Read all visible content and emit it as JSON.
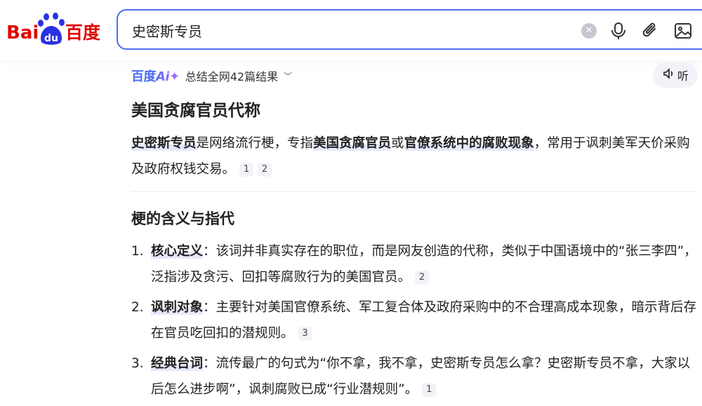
{
  "brand": {
    "logo_text_latin": "Bai",
    "logo_text_du": "du",
    "logo_text_cn": "百度",
    "colors": {
      "red": "#e10601",
      "blue": "#2932e1",
      "accent": "#4e6ef2"
    }
  },
  "search": {
    "query": "史密斯专员",
    "icons": [
      "clear-icon",
      "microphone-icon",
      "attachment-icon",
      "image-search-icon"
    ]
  },
  "ai_bar": {
    "logo": "百度",
    "logo_ai": "Ai",
    "summary": "总结全网42篇结果",
    "listen_label": "听"
  },
  "answer": {
    "title": "美国贪腐官员代称",
    "intro": {
      "part1": "史密斯专员",
      "part2": "是网络流行梗，专指",
      "part3": "美国贪腐官员",
      "part4": "或",
      "part5": "官僚系统中的腐败现象",
      "part6": "，常用于讽刺美军天价采购及政府权钱交易。",
      "cites": [
        "1",
        "2"
      ]
    },
    "section_title": "梗的含义与指代",
    "items": [
      {
        "num": "1.",
        "term": "核心定义",
        "text": "：该词并非真实存在的职位，而是网友创造的代称，类似于中国语境中的“张三李四”，泛指涉及贪污、回扣等腐败行为的美国官员。",
        "cite": "2"
      },
      {
        "num": "2.",
        "term": "讽刺对象",
        "text": "：主要针对美国官僚系统、军工复合体及政府采购中的不合理高成本现象，暗示背后存在官员吃回扣的潜规则。",
        "cite": "3"
      },
      {
        "num": "3.",
        "term": "经典台词",
        "text": "：流传最广的句式为“你不拿，我不拿，史密斯专员怎么拿？史密斯专员不拿，大家以后怎么进步啊”，讽刺腐败已成“行业潜规则”。",
        "cite": "1"
      }
    ]
  }
}
